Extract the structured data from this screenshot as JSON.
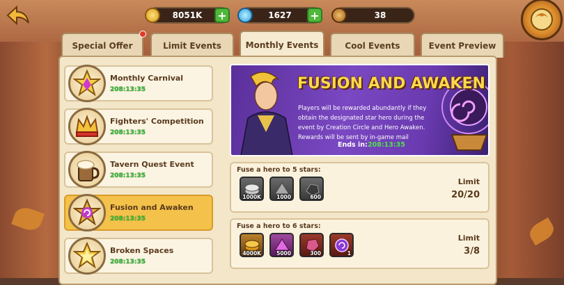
{
  "header": {
    "gold": "8051K",
    "diamonds": "1627",
    "stamina": "38"
  },
  "tabs": [
    {
      "label": "Special Offer"
    },
    {
      "label": "Limit Events"
    },
    {
      "label": "Monthly Events"
    },
    {
      "label": "Cool Events"
    },
    {
      "label": "Event Preview"
    }
  ],
  "active_tab": "Monthly Events",
  "events": [
    {
      "name": "Monthly Carnival",
      "time": "208:13:35",
      "icon": "star-gem-icon"
    },
    {
      "name": "Fighters' Competition",
      "time": "208:13:35",
      "icon": "crown-icon"
    },
    {
      "name": "Tavern Quest Event",
      "time": "208:13:35",
      "icon": "mug-icon"
    },
    {
      "name": "Fusion and Awaken",
      "time": "208:13:35",
      "icon": "spiral-star-icon"
    },
    {
      "name": "Broken Spaces",
      "time": "208:13:35",
      "icon": "gold-star-icon"
    }
  ],
  "selected_event": "Fusion and Awaken",
  "banner": {
    "title": "FUSION AND AWAKEN",
    "description": "Players will be rewarded abundantly if they obtain the designated star hero during the event by Creation Circle and Hero Awaken. Rewards will be sent by in-game mail",
    "ends_label": "Ends in:",
    "ends_value": "208:13:35"
  },
  "rewards": [
    {
      "label": "Fuse a hero to 5 stars:",
      "limit_label": "Limit",
      "limit_value": "20/20",
      "items": [
        {
          "icon": "silver-coin-icon",
          "qty": "1000K"
        },
        {
          "icon": "gray-dust-icon",
          "qty": "1000"
        },
        {
          "icon": "dark-ore-icon",
          "qty": "600"
        }
      ]
    },
    {
      "label": "Fuse a hero to 6 stars:",
      "limit_label": "Limit",
      "limit_value": "3/8",
      "items": [
        {
          "icon": "gold-coin-icon",
          "qty": "4000K"
        },
        {
          "icon": "purple-dust-icon",
          "qty": "5000"
        },
        {
          "icon": "red-crystal-icon",
          "qty": "300"
        },
        {
          "icon": "purple-orb-icon",
          "qty": "1"
        }
      ]
    }
  ],
  "colors": {
    "accent_gold": "#f4c24a",
    "timer_green": "#3bb83a",
    "banner_purple": "#6a3ab0",
    "plus_green": "#4fb83a"
  }
}
